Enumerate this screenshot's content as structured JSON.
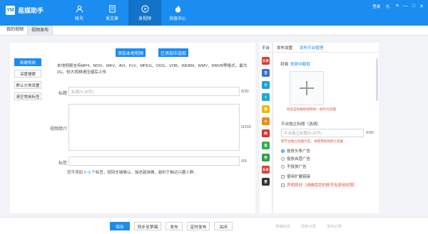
{
  "app": {
    "name": "易媒助手",
    "logo_text": "YM"
  },
  "nav": [
    {
      "label": "帐号",
      "icon": "user-icon"
    },
    {
      "label": "发文章",
      "icon": "document-icon"
    },
    {
      "label": "发视频",
      "icon": "play-icon",
      "active": true
    },
    {
      "label": "消息中心",
      "icon": "fire-icon"
    }
  ],
  "top_right": {
    "login": "登录",
    "gift": "礼",
    "menu": "≡",
    "minimize": "—",
    "maximize": "□",
    "close": "✕"
  },
  "subtabs": [
    "我的视频",
    "视频发布"
  ],
  "side_buttons": [
    "新建视频",
    "深度搜索",
    "默认分类设置",
    "清空常用标签"
  ],
  "upload_buttons": {
    "local": "添加本地视频",
    "added": "已添加中选取"
  },
  "support_text": "本地视频支持MP4、MOV、MKV、AVI、FLV、MPEG、OGG、VOB、WEBM、WMV、RMVB等格式，最大2G，较大视频请压缩后上传",
  "form": {
    "title_label": "标题",
    "title_placeholder": "标题(5-30字)",
    "title_count": "0/30",
    "intro_label": "视频简介",
    "intro_count": "0/200",
    "tags_label": "标签",
    "tags_count": "0/9",
    "hint_pre": "您可添加",
    "hint_range": "2~9",
    "hint_post": "个标签，按回车键确认。描述越准确，越利于触达兴趣人群。"
  },
  "platform": {
    "header": "平台",
    "icons": [
      {
        "name": "toutiao-icon",
        "text": "头条",
        "color": "#e23a2c"
      },
      {
        "name": "baijia-icon",
        "text": "百",
        "color": "#3b6fd8"
      },
      {
        "name": "dayu-icon",
        "text": "大",
        "color": "#1aa0d8"
      },
      {
        "name": "yidian-icon",
        "text": "1",
        "color": "#1ab0c8"
      },
      {
        "name": "sohu-icon",
        "text": "搜",
        "color": "#f2b600"
      },
      {
        "name": "douyu-icon",
        "text": "D",
        "color": "#f08a1b"
      },
      {
        "name": "wangyi-icon",
        "text": "网",
        "color": "#d8352a"
      },
      {
        "name": "aiqiyi-icon",
        "text": "爱",
        "color": "#2cb24a"
      },
      {
        "name": "kuaishou-icon",
        "text": "快",
        "color": "#2ba245"
      },
      {
        "name": "xigua-icon",
        "text": "头条",
        "color": "#e23a2c"
      },
      {
        "name": "more-icon",
        "text": "更",
        "color": "#333333"
      }
    ]
  },
  "right_panel": {
    "tabs": [
      "发布设置",
      "发布平台管理"
    ],
    "cover_label": "封面",
    "cover_link": "视频中截取",
    "cover_note": "恢复自动截取视频第一帧作为封面",
    "standalone_title_label": "平台独立标题（选填）",
    "standalone_title_placeholder": "平台独立标题(5-30字)",
    "standalone_title_count": "0/30",
    "standalone_note": "若平台独立标题为空，将使用视频默认标题",
    "radio_options": [
      {
        "label": "投放头条广告",
        "checked": true
      },
      {
        "label": "投放自营广告",
        "checked": false
      },
      {
        "label": "不投放广告",
        "checked": false
      }
    ],
    "checkbox_options": [
      {
        "label": "使用扩展链接"
      },
      {
        "label": "声明原创（请确保您的账号有原创权限）"
      }
    ]
  },
  "bottom": {
    "buttons": [
      "保存",
      "同步至草稿",
      "发布",
      "定时发布",
      "关闭"
    ],
    "links": [
      "草稿状态",
      "同步记录",
      "发布记录"
    ]
  }
}
